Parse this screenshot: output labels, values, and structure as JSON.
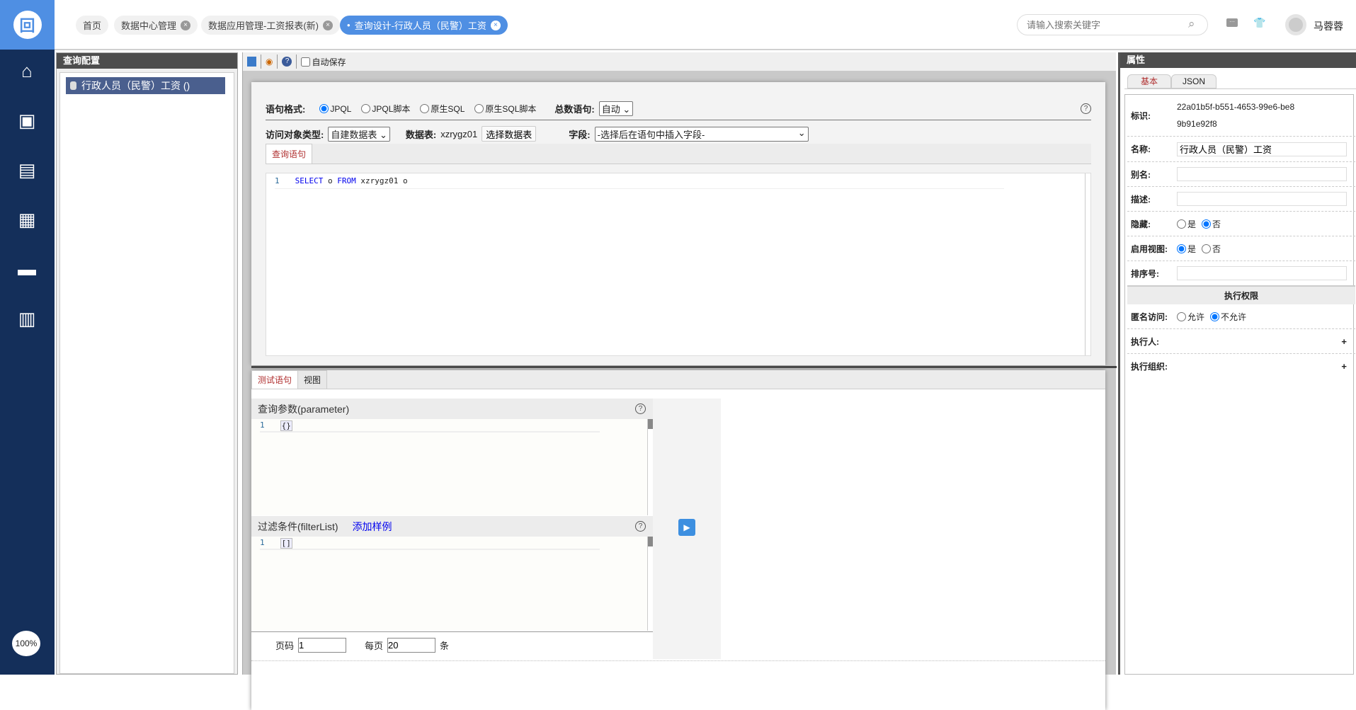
{
  "header": {
    "logo": "回",
    "tabs": [
      {
        "label": "首页",
        "closable": false
      },
      {
        "label": "数据中心管理",
        "closable": true
      },
      {
        "label": "数据应用管理-工资报表(新)",
        "closable": true
      },
      {
        "label": "查询设计-行政人员（民警）工资",
        "closable": true,
        "active": true
      }
    ],
    "search_placeholder": "请输入搜索关键字",
    "user": "马蓉蓉"
  },
  "sidebar": {
    "icons": [
      "home-icon",
      "monitor-user-icon",
      "newspaper-icon",
      "calendar-icon",
      "cloud-folder-icon",
      "bar-chart-icon"
    ],
    "zoom": "100%"
  },
  "left_panel": {
    "title": "查询配置",
    "tree_item": "行政人员（民警）工资 ()"
  },
  "toolbar": {
    "autosave": "自动保存"
  },
  "query": {
    "format_label": "语句格式:",
    "formats": [
      "JPQL",
      "JPQL脚本",
      "原生SQL",
      "原生SQL脚本"
    ],
    "selected_format": "JPQL",
    "count_label": "总数语句:",
    "count_value": "自动",
    "access_label": "访问对象类型:",
    "access_value": "自建数据表",
    "table_label": "数据表:",
    "table_value": "xzrygz01",
    "select_table_btn": "选择数据表",
    "field_label": "字段:",
    "field_value": "-选择后在语句中插入字段-",
    "tab": "查询语句",
    "code": {
      "line": "1",
      "kw1": "SELECT",
      "t1": " o ",
      "kw2": "FROM",
      "t2": " xzrygz01 o"
    }
  },
  "test": {
    "tabs": [
      "测试语句",
      "视图"
    ],
    "param_title": "查询参数(parameter)",
    "param_code": "{}",
    "filter_title": "过滤条件(filterList)",
    "add_sample": "添加样例",
    "filter_code": "[]",
    "line": "1",
    "page_label": "页码",
    "page_value": "1",
    "per_page_label": "每页",
    "per_page_value": "20",
    "per_page_unit": "条"
  },
  "properties": {
    "title": "属性",
    "tabs": [
      "基本",
      "JSON"
    ],
    "id_label": "标识:",
    "id_value": "22a01b5f-b551-4653-99e6-be89b91e92f8",
    "name_label": "名称:",
    "name_value": "行政人员（民警）工资",
    "alias_label": "别名:",
    "desc_label": "描述:",
    "hidden_label": "隐藏:",
    "enable_view_label": "启用视图:",
    "yes": "是",
    "no": "否",
    "sort_label": "排序号:",
    "perm_title": "执行权限",
    "anon_label": "匿名访问:",
    "allow": "允许",
    "deny": "不允许",
    "executor_label": "执行人:",
    "exec_org_label": "执行组织:",
    "add": "+"
  }
}
